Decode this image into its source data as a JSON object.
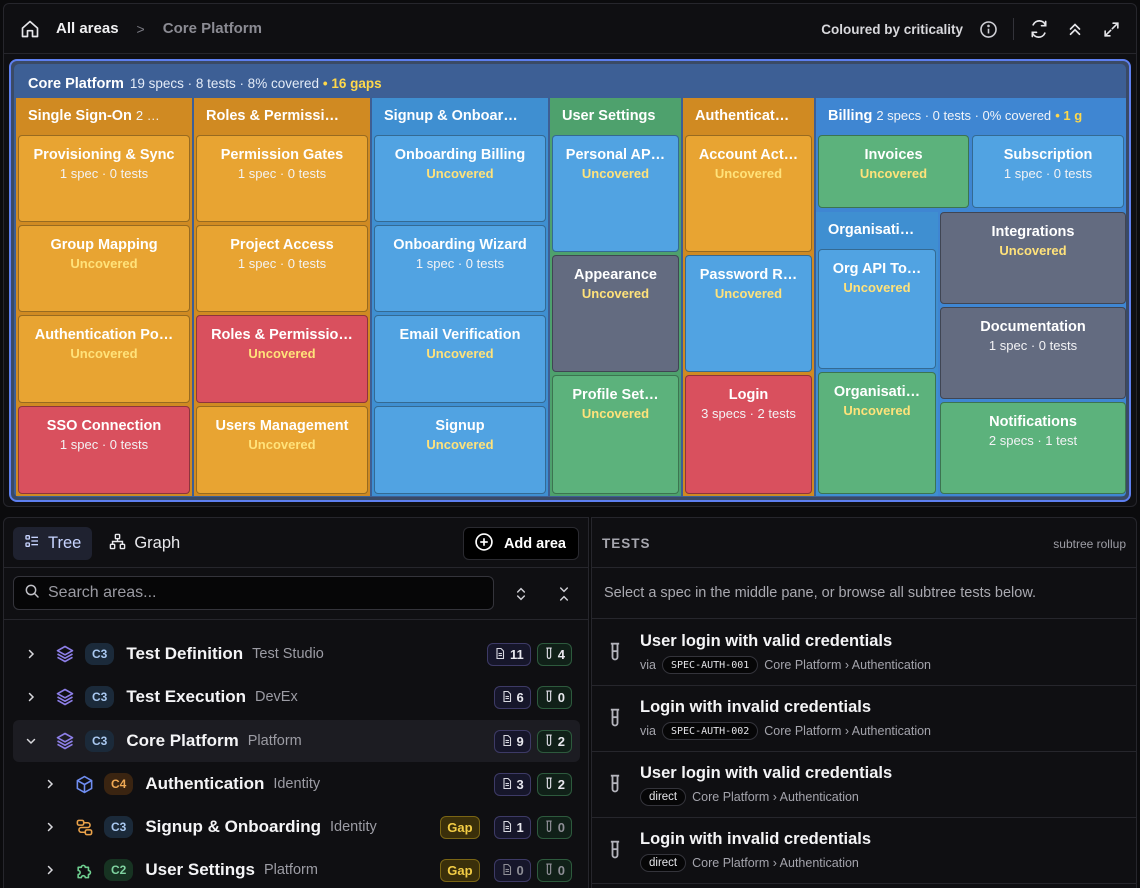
{
  "breadcrumb": {
    "root": "All areas",
    "sep": ">",
    "current": "Core Platform"
  },
  "toolbar": {
    "colour_label": "Coloured by criticality"
  },
  "treemap": {
    "title": "Core Platform",
    "stats": "19 specs · 8 tests · 8% covered",
    "gaps": "• 16 gaps",
    "groups": {
      "sso": {
        "title": "Single Sign-On",
        "stats": "2 …"
      },
      "roles": {
        "title": "Roles & Permissi…"
      },
      "signup": {
        "title": "Signup & Onboar…"
      },
      "user": {
        "title": "User Settings"
      },
      "auth": {
        "title": "Authenticat…"
      },
      "billing": {
        "title": "Billing",
        "stats": "2 specs · 0 tests · 0% covered",
        "gaps": "• 1 g"
      },
      "org": {
        "title": "Organisati…"
      }
    },
    "tiles": {
      "prov": {
        "name": "Provisioning & Sync",
        "sub": "1 spec · 0 tests"
      },
      "group": {
        "name": "Group Mapping",
        "sub": "Uncovered"
      },
      "authpo": {
        "name": "Authentication Po…",
        "sub": "Uncovered"
      },
      "ssoconn": {
        "name": "SSO Connection",
        "sub": "1 spec · 0 tests"
      },
      "permg": {
        "name": "Permission Gates",
        "sub": "1 spec · 0 tests"
      },
      "proj": {
        "name": "Project Access",
        "sub": "1 spec · 0 tests"
      },
      "rolesp": {
        "name": "Roles & Permissio…",
        "sub": "Uncovered"
      },
      "users": {
        "name": "Users Management",
        "sub": "Uncovered"
      },
      "obill": {
        "name": "Onboarding Billing",
        "sub": "Uncovered"
      },
      "owiz": {
        "name": "Onboarding Wizard",
        "sub": "1 spec · 0 tests"
      },
      "email": {
        "name": "Email Verification",
        "sub": "Uncovered"
      },
      "signup": {
        "name": "Signup",
        "sub": "Uncovered"
      },
      "papi": {
        "name": "Personal AP…",
        "sub": "Uncovered"
      },
      "appear": {
        "name": "Appearance",
        "sub": "Uncovered"
      },
      "profile": {
        "name": "Profile Set…",
        "sub": "Uncovered"
      },
      "acct": {
        "name": "Account Act…",
        "sub": "Uncovered"
      },
      "pwd": {
        "name": "Password R…",
        "sub": "Uncovered"
      },
      "login": {
        "name": "Login",
        "sub": "3 specs · 2 tests"
      },
      "invoices": {
        "name": "Invoices",
        "sub": "Uncovered"
      },
      "subs": {
        "name": "Subscription",
        "sub": "1 spec · 0 tests"
      },
      "orgapi": {
        "name": "Org API To…",
        "sub": "Uncovered"
      },
      "orgs2": {
        "name": "Organisati…",
        "sub": "Uncovered"
      },
      "integ": {
        "name": "Integrations",
        "sub": "Uncovered"
      },
      "docs": {
        "name": "Documentation",
        "sub": "1 spec · 0 tests"
      },
      "notif": {
        "name": "Notifications",
        "sub": "2 specs · 1 test"
      }
    }
  },
  "left": {
    "tab_tree": "Tree",
    "tab_graph": "Graph",
    "add_area": "Add area",
    "search_placeholder": "Search areas...",
    "rows": [
      {
        "crit": "C3",
        "name": "Test Definition",
        "team": "Test Studio",
        "specs": "11",
        "tests": "4"
      },
      {
        "crit": "C3",
        "name": "Test Execution",
        "team": "DevEx",
        "specs": "6",
        "tests": "0"
      },
      {
        "crit": "C3",
        "name": "Core Platform",
        "team": "Platform",
        "specs": "9",
        "tests": "2"
      },
      {
        "crit": "C4",
        "name": "Authentication",
        "team": "Identity",
        "specs": "3",
        "tests": "2"
      },
      {
        "crit": "C3",
        "name": "Signup & Onboarding",
        "team": "Identity",
        "gap": "Gap",
        "specs": "1",
        "tests": "0"
      },
      {
        "crit": "C2",
        "name": "User Settings",
        "team": "Platform",
        "gap": "Gap",
        "specs": "0",
        "tests": "0"
      }
    ]
  },
  "right": {
    "title": "TESTS",
    "rollup": "subtree rollup",
    "hint": "Select a spec in the middle pane, or browse all subtree tests below.",
    "tests": [
      {
        "title": "User login with valid credentials",
        "via": "via",
        "pill": "SPEC-AUTH-001",
        "path": "Core Platform › Authentication"
      },
      {
        "title": "Login with invalid credentials",
        "via": "via",
        "pill": "SPEC-AUTH-002",
        "path": "Core Platform › Authentication"
      },
      {
        "title": "User login with valid credentials",
        "pill": "direct",
        "path": "Core Platform › Authentication"
      },
      {
        "title": "Login with invalid credentials",
        "pill": "direct",
        "path": "Core Platform › Authentication"
      }
    ]
  },
  "colors": {
    "accent": "#5d7ff0",
    "gap": "#ffd84a",
    "critical_red": "#d9505e",
    "high_orange": "#e8a432",
    "medium_blue": "#51a3e2",
    "low_green": "#5cb27c",
    "none_slate": "#636b80"
  }
}
